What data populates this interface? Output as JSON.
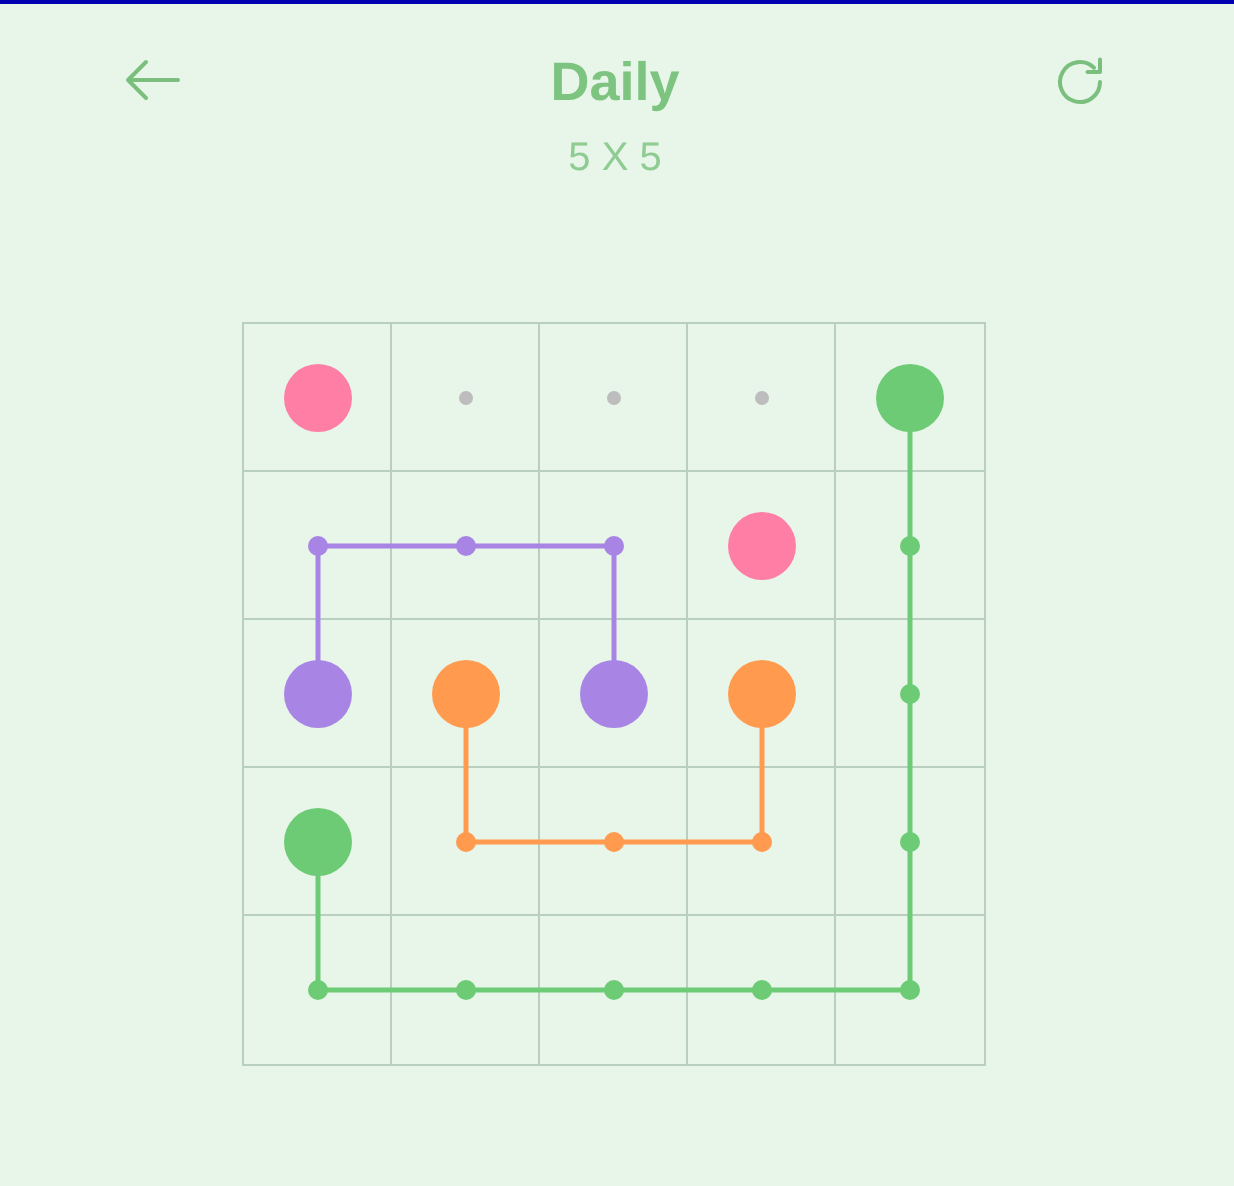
{
  "header": {
    "title": "Daily",
    "subtitle": "5 X 5"
  },
  "board": {
    "rows": [
      {
        "cells": [
          {
            "kind": "endpoint",
            "color": "#ff7ea6",
            "up": false,
            "down": false,
            "left": false,
            "right": false
          },
          {
            "kind": "empty"
          },
          {
            "kind": "empty"
          },
          {
            "kind": "empty"
          },
          {
            "kind": "endpoint",
            "color": "#6ccb74",
            "up": false,
            "down": true,
            "left": false,
            "right": false
          }
        ]
      },
      {
        "cells": [
          {
            "kind": "path",
            "color": "#a884e4",
            "up": false,
            "down": true,
            "left": false,
            "right": true
          },
          {
            "kind": "path",
            "color": "#a884e4",
            "up": false,
            "down": false,
            "left": true,
            "right": true
          },
          {
            "kind": "path",
            "color": "#a884e4",
            "up": false,
            "down": true,
            "left": true,
            "right": false
          },
          {
            "kind": "endpoint",
            "color": "#ff7ea6",
            "up": false,
            "down": false,
            "left": false,
            "right": false
          },
          {
            "kind": "path",
            "color": "#6ccb74",
            "up": true,
            "down": true,
            "left": false,
            "right": false
          }
        ]
      },
      {
        "cells": [
          {
            "kind": "endpoint",
            "color": "#a884e4",
            "up": true,
            "down": false,
            "left": false,
            "right": false
          },
          {
            "kind": "endpoint",
            "color": "#ff9a4f",
            "up": false,
            "down": true,
            "left": false,
            "right": false
          },
          {
            "kind": "endpoint",
            "color": "#a884e4",
            "up": true,
            "down": false,
            "left": false,
            "right": false
          },
          {
            "kind": "endpoint",
            "color": "#ff9a4f",
            "up": false,
            "down": true,
            "left": false,
            "right": false
          },
          {
            "kind": "path",
            "color": "#6ccb74",
            "up": true,
            "down": true,
            "left": false,
            "right": false
          }
        ]
      },
      {
        "cells": [
          {
            "kind": "endpoint",
            "color": "#6ccb74",
            "up": false,
            "down": true,
            "left": false,
            "right": false
          },
          {
            "kind": "path",
            "color": "#ff9a4f",
            "up": true,
            "down": false,
            "left": false,
            "right": true
          },
          {
            "kind": "path",
            "color": "#ff9a4f",
            "up": false,
            "down": false,
            "left": true,
            "right": true
          },
          {
            "kind": "path",
            "color": "#ff9a4f",
            "up": true,
            "down": false,
            "left": true,
            "right": false
          },
          {
            "kind": "path",
            "color": "#6ccb74",
            "up": true,
            "down": true,
            "left": false,
            "right": false
          }
        ]
      },
      {
        "cells": [
          {
            "kind": "path",
            "color": "#6ccb74",
            "up": true,
            "down": false,
            "left": false,
            "right": true
          },
          {
            "kind": "path",
            "color": "#6ccb74",
            "up": false,
            "down": false,
            "left": true,
            "right": true
          },
          {
            "kind": "path",
            "color": "#6ccb74",
            "up": false,
            "down": false,
            "left": true,
            "right": true
          },
          {
            "kind": "path",
            "color": "#6ccb74",
            "up": false,
            "down": false,
            "left": true,
            "right": true
          },
          {
            "kind": "path",
            "color": "#6ccb74",
            "up": true,
            "down": false,
            "left": true,
            "right": false
          }
        ]
      }
    ]
  }
}
